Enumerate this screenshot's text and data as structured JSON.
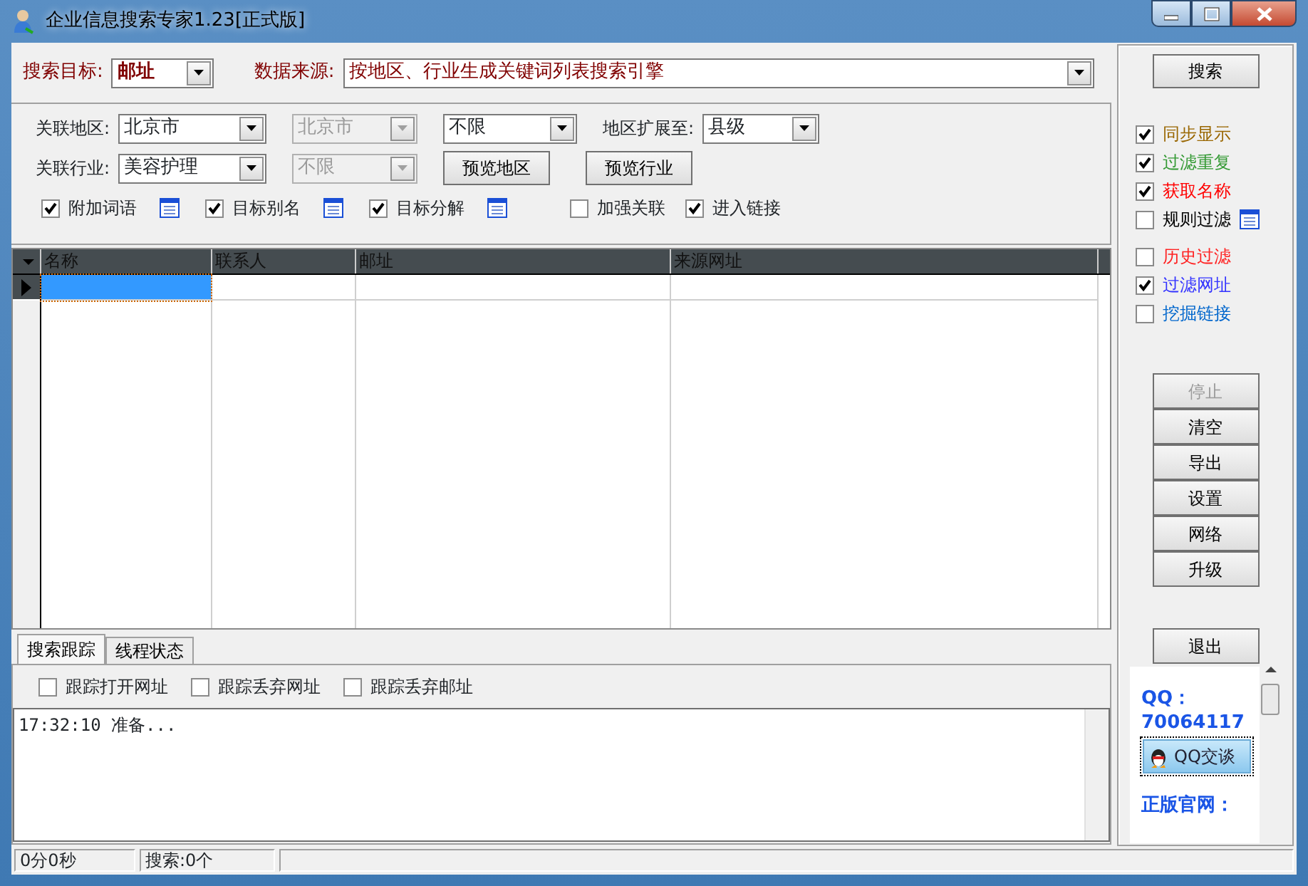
{
  "window": {
    "title": "企业信息搜索专家1.23[正式版]"
  },
  "target": {
    "label": "搜索目标:",
    "value": "邮址"
  },
  "source": {
    "label": "数据来源:",
    "value": "按地区、行业生成关键词列表搜索引擎"
  },
  "filters": {
    "region_label": "关联地区:",
    "region_combos": [
      {
        "value": "北京市",
        "disabled": false
      },
      {
        "value": "北京市",
        "disabled": true
      },
      {
        "value": "不限",
        "disabled": false
      }
    ],
    "expand_label": "地区扩展至:",
    "expand_value": "县级",
    "industry_label": "关联行业:",
    "industry_combos": [
      {
        "value": "美容护理",
        "disabled": false
      },
      {
        "value": "不限",
        "disabled": true
      }
    ],
    "buttons": [
      "预览地区",
      "预览行业"
    ],
    "options": [
      {
        "label": "附加词语",
        "checked": true,
        "has_icon": true
      },
      {
        "label": "目标别名",
        "checked": true,
        "has_icon": true
      },
      {
        "label": "目标分解",
        "checked": true,
        "has_icon": true
      },
      {
        "label": "加强关联",
        "checked": false,
        "has_icon": false
      },
      {
        "label": "进入链接",
        "checked": true,
        "has_icon": false
      }
    ]
  },
  "table": {
    "columns": [
      "名称",
      "联系人",
      "邮址",
      "来源网址"
    ]
  },
  "tabs": [
    {
      "label": "搜索跟踪",
      "selected": true
    },
    {
      "label": "线程状态",
      "selected": false
    }
  ],
  "trace_options": [
    {
      "label": "跟踪打开网址",
      "checked": false
    },
    {
      "label": "跟踪丢弃网址",
      "checked": false
    },
    {
      "label": "跟踪丢弃邮址",
      "checked": false
    }
  ],
  "log": [
    "17:32:10 准备..."
  ],
  "side": {
    "search_button": "搜索",
    "options": [
      {
        "label": "同步显示",
        "checked": true,
        "color": "#996600",
        "has_icon": false
      },
      {
        "label": "过滤重复",
        "checked": true,
        "color": "#339933",
        "has_icon": false
      },
      {
        "label": "获取名称",
        "checked": true,
        "color": "#ff0000",
        "has_icon": false
      },
      {
        "label": "规则过滤",
        "checked": false,
        "color": "#000000",
        "has_icon": true
      },
      {
        "label": "历史过滤",
        "checked": false,
        "color": "#ff2020",
        "has_icon": false
      },
      {
        "label": "过滤网址",
        "checked": true,
        "color": "#3333ff",
        "has_icon": false
      },
      {
        "label": "挖掘链接",
        "checked": false,
        "color": "#0066cc",
        "has_icon": false
      }
    ],
    "actions": [
      {
        "label": "停止",
        "disabled": true
      },
      {
        "label": "清空",
        "disabled": false
      },
      {
        "label": "导出",
        "disabled": false
      },
      {
        "label": "设置",
        "disabled": false
      },
      {
        "label": "网络",
        "disabled": false
      },
      {
        "label": "升级",
        "disabled": false
      }
    ],
    "exit_button": "退出"
  },
  "qq": {
    "label": "QQ：",
    "number": "70064117",
    "chat_button": "QQ交谈",
    "site_label": "正版官网："
  },
  "status_bar": [
    "0分0秒",
    "搜索:0个"
  ]
}
